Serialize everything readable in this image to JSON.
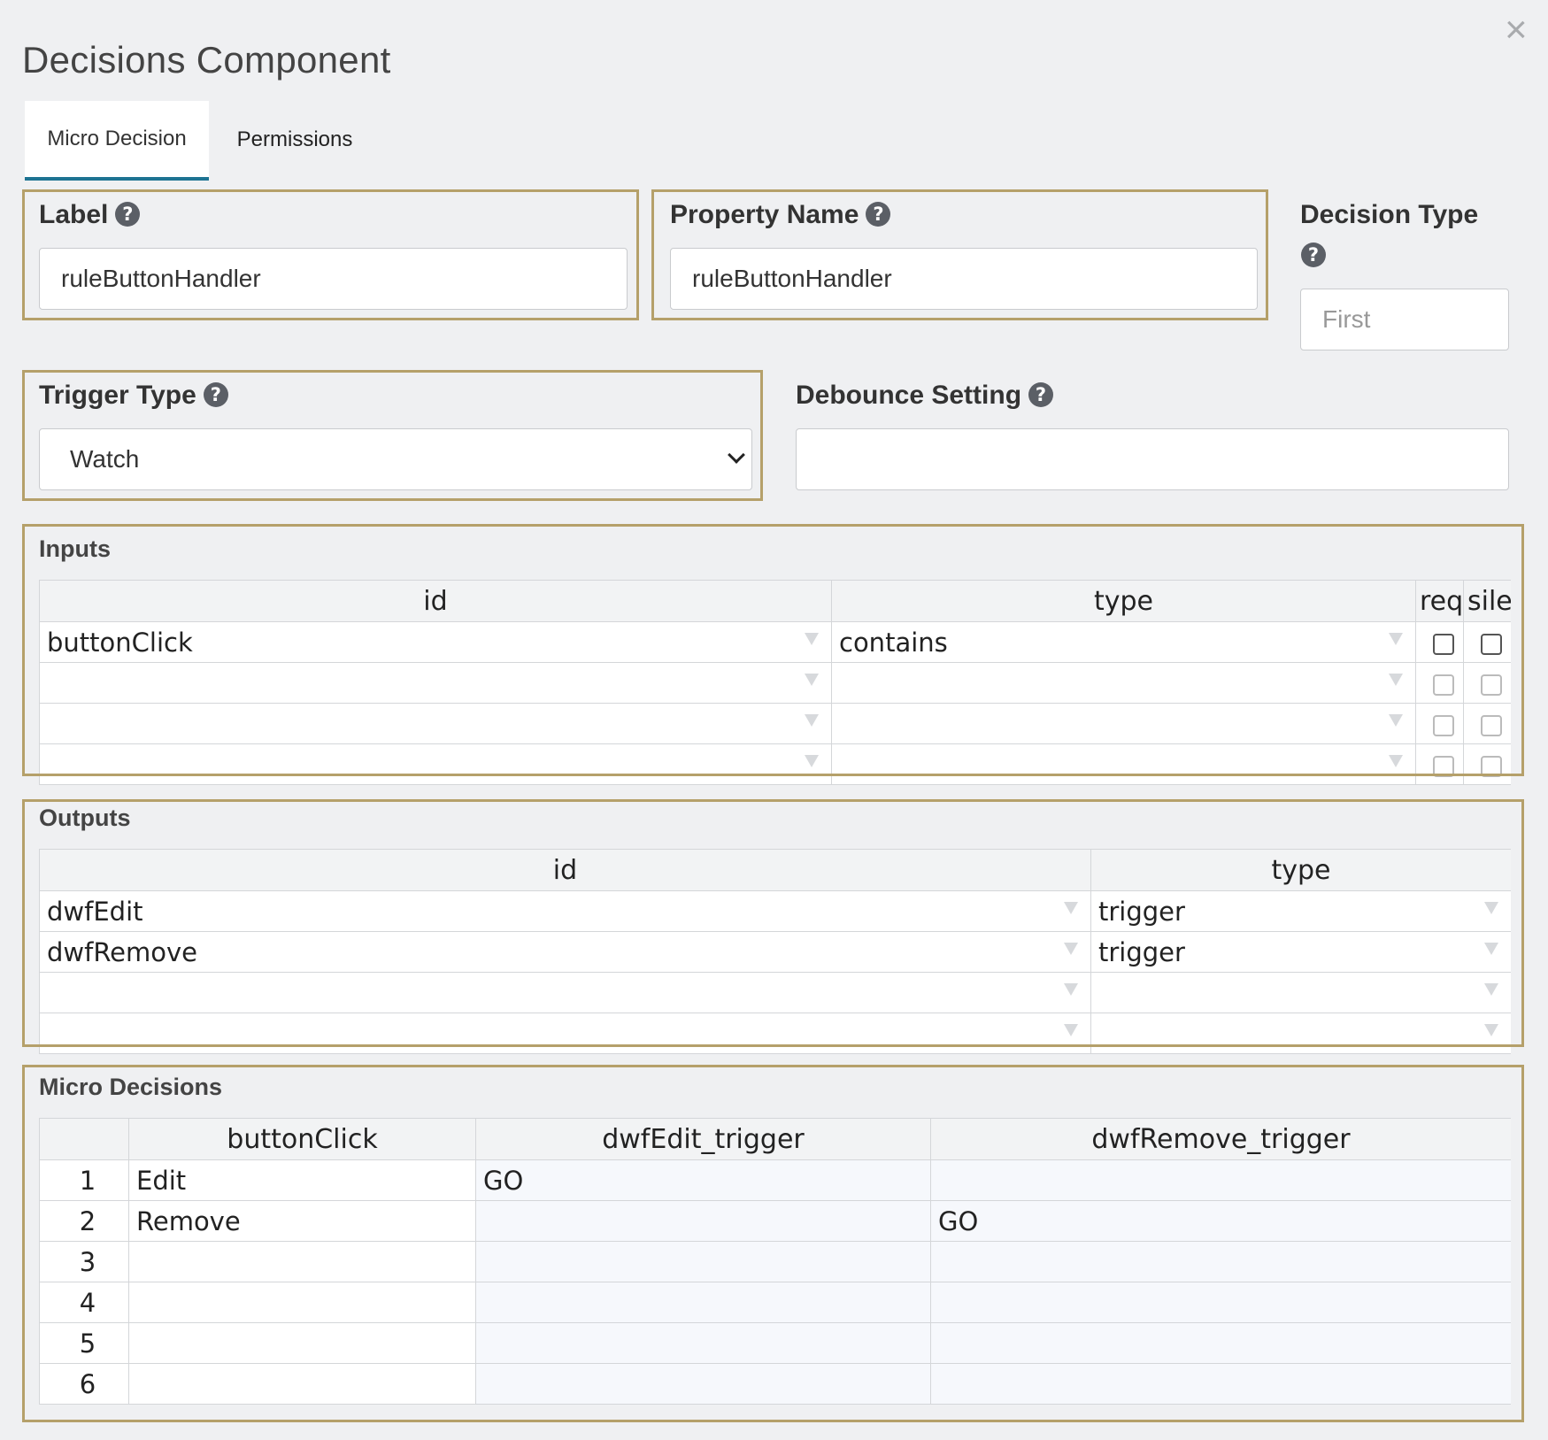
{
  "dialog": {
    "title": "Decisions Component",
    "close": "×"
  },
  "tabs": [
    {
      "label": "Micro Decision"
    },
    {
      "label": "Permissions"
    }
  ],
  "fields": {
    "label": {
      "label": "Label",
      "value": "ruleButtonHandler"
    },
    "property_name": {
      "label": "Property Name",
      "value": "ruleButtonHandler"
    },
    "decision_type": {
      "label": "Decision Type",
      "value": "First"
    },
    "trigger_type": {
      "label": "Trigger Type",
      "value": "Watch"
    },
    "debounce": {
      "label": "Debounce Setting",
      "value": ""
    }
  },
  "help_glyph": "?",
  "inputs": {
    "title": "Inputs",
    "columns": [
      "id",
      "type",
      "req",
      "sile"
    ],
    "rows": [
      {
        "id": "buttonClick",
        "type": "contains"
      },
      {
        "id": "",
        "type": ""
      },
      {
        "id": "",
        "type": ""
      },
      {
        "id": "",
        "type": ""
      }
    ]
  },
  "outputs": {
    "title": "Outputs",
    "columns": [
      "id",
      "type"
    ],
    "rows": [
      {
        "id": "dwfEdit",
        "type": "trigger"
      },
      {
        "id": "dwfRemove",
        "type": "trigger"
      },
      {
        "id": "",
        "type": ""
      },
      {
        "id": "",
        "type": ""
      }
    ]
  },
  "micro_decisions": {
    "title": "Micro Decisions",
    "columns": [
      "",
      "buttonClick",
      "dwfEdit_trigger",
      "dwfRemove_trigger"
    ],
    "rows": [
      {
        "n": "1",
        "buttonClick": "Edit",
        "dwfEdit_trigger": "GO",
        "dwfRemove_trigger": ""
      },
      {
        "n": "2",
        "buttonClick": "Remove",
        "dwfEdit_trigger": "",
        "dwfRemove_trigger": "GO"
      },
      {
        "n": "3",
        "buttonClick": "",
        "dwfEdit_trigger": "",
        "dwfRemove_trigger": ""
      },
      {
        "n": "4",
        "buttonClick": "",
        "dwfEdit_trigger": "",
        "dwfRemove_trigger": ""
      },
      {
        "n": "5",
        "buttonClick": "",
        "dwfEdit_trigger": "",
        "dwfRemove_trigger": ""
      },
      {
        "n": "6",
        "buttonClick": "",
        "dwfEdit_trigger": "",
        "dwfRemove_trigger": ""
      }
    ]
  }
}
